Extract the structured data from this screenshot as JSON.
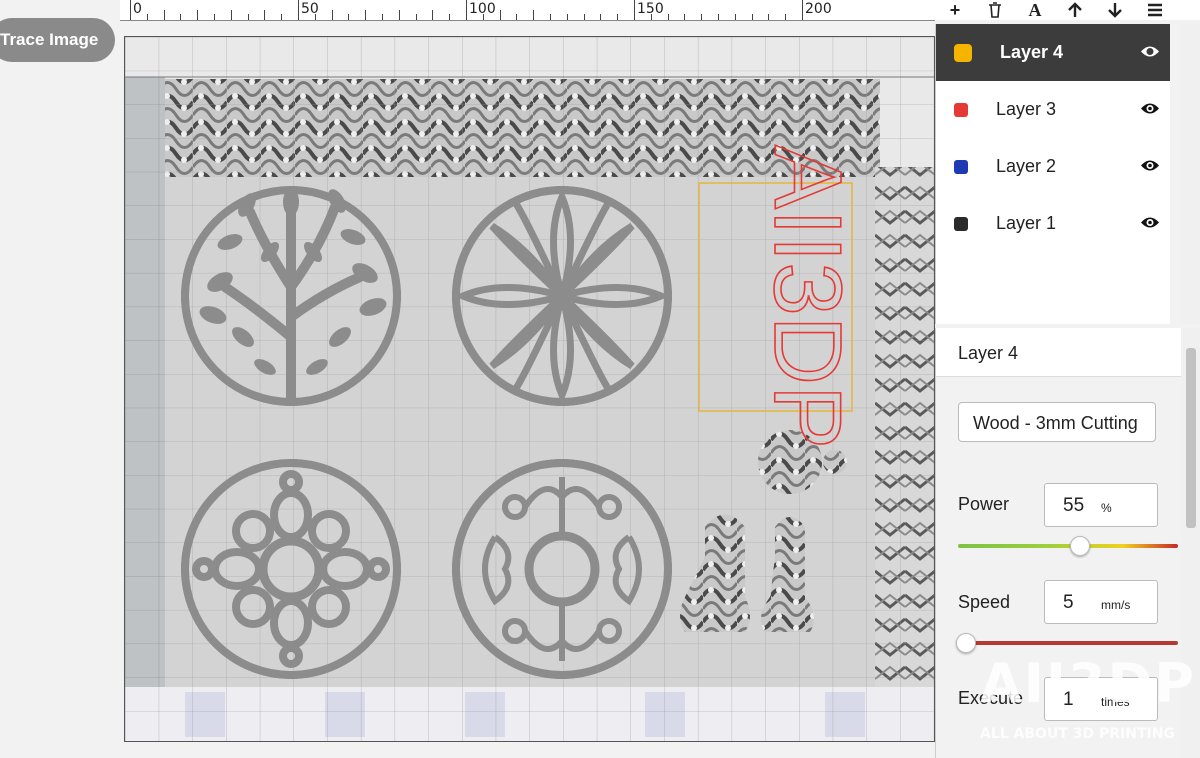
{
  "trace_button": "Trace Image",
  "ruler": {
    "labels": [
      "0",
      "50",
      "100",
      "150",
      "200"
    ]
  },
  "toolbar": {
    "icons": [
      "add-icon",
      "trash-icon",
      "text-icon",
      "arrow-up-icon",
      "arrow-down-icon",
      "menu-icon"
    ]
  },
  "canvas": {
    "engrave_text": "AII3DP",
    "colors": {
      "cut_fill": "#8c8c8c",
      "outline": "#1c2fb0",
      "text": "#e53935",
      "selection": "#e7b53a"
    }
  },
  "layers": [
    {
      "name": "Layer 4",
      "color": "#f5b400",
      "active": true
    },
    {
      "name": "Layer 3",
      "color": "#e53935",
      "active": false
    },
    {
      "name": "Layer 2",
      "color": "#1e3bb3",
      "active": false
    },
    {
      "name": "Layer 1",
      "color": "#2a2a2a",
      "active": false
    }
  ],
  "settings": {
    "title": "Layer 4",
    "preset": "Wood - 3mm Cutting",
    "power": {
      "label": "Power",
      "value": "55",
      "unit": "%",
      "level": 0.55
    },
    "speed": {
      "label": "Speed",
      "value": "5",
      "unit": "mm/s",
      "level": 0.03
    },
    "execute": {
      "label": "Execute",
      "value": "1",
      "unit": "times"
    }
  },
  "watermark": {
    "logo": "AII3DP",
    "tagline": "ALL ABOUT 3D PRINTING"
  }
}
